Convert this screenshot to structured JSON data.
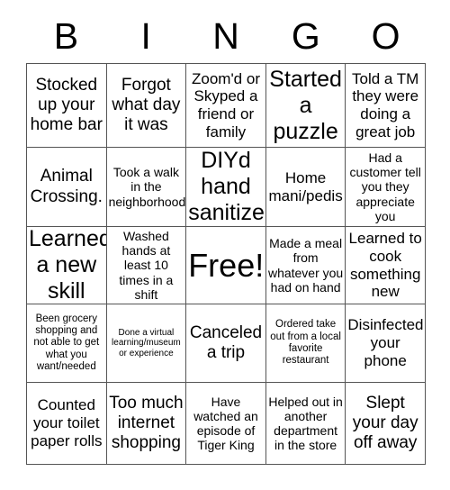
{
  "card": {
    "title_letters": [
      "B",
      "I",
      "N",
      "G",
      "O"
    ],
    "free_space_label": "Free!",
    "rows": [
      [
        {
          "text": "Stocked up your home bar",
          "size": "fs-lg"
        },
        {
          "text": "Forgot what day it was",
          "size": "fs-lg"
        },
        {
          "text": "Zoom'd or Skyped a friend or family",
          "size": "fs-md"
        },
        {
          "text": "Started a puzzle",
          "size": "fs-xl"
        },
        {
          "text": "Told a TM they were doing a great job",
          "size": "fs-md"
        }
      ],
      [
        {
          "text": "Animal Crossing.",
          "size": "fs-lg"
        },
        {
          "text": "Took a walk in the neighborhood",
          "size": "fs-sm"
        },
        {
          "text": "DIYd hand sanitizer",
          "size": "fs-xl"
        },
        {
          "text": "Home mani/pedis",
          "size": "fs-md"
        },
        {
          "text": "Had a customer tell you they appreciate you",
          "size": "fs-sm"
        }
      ],
      [
        {
          "text": "Learned a new skill",
          "size": "fs-xl"
        },
        {
          "text": "Washed hands at least 10 times in a shift",
          "size": "fs-sm"
        },
        {
          "text": "Free!",
          "size": "free"
        },
        {
          "text": "Made a meal from whatever you had on hand",
          "size": "fs-sm"
        },
        {
          "text": "Learned to cook something new",
          "size": "fs-md"
        }
      ],
      [
        {
          "text": "Been grocery shopping and not able to get what you want/needed",
          "size": "fs-xs"
        },
        {
          "text": "Done a virtual learning/museum or experience",
          "size": "fs-xxs"
        },
        {
          "text": "Canceled a trip",
          "size": "fs-lg"
        },
        {
          "text": "Ordered take out from a local favorite restaurant",
          "size": "fs-xs"
        },
        {
          "text": "Disinfected your phone",
          "size": "fs-md"
        }
      ],
      [
        {
          "text": "Counted your toilet paper rolls",
          "size": "fs-md"
        },
        {
          "text": "Too much internet shopping",
          "size": "fs-lg"
        },
        {
          "text": "Have watched an episode of Tiger King",
          "size": "fs-sm"
        },
        {
          "text": "Helped out in another department in the store",
          "size": "fs-sm"
        },
        {
          "text": "Slept your day off away",
          "size": "fs-lg"
        }
      ]
    ]
  },
  "colors": {
    "border": "#555555",
    "text": "#000000",
    "background": "#ffffff"
  }
}
